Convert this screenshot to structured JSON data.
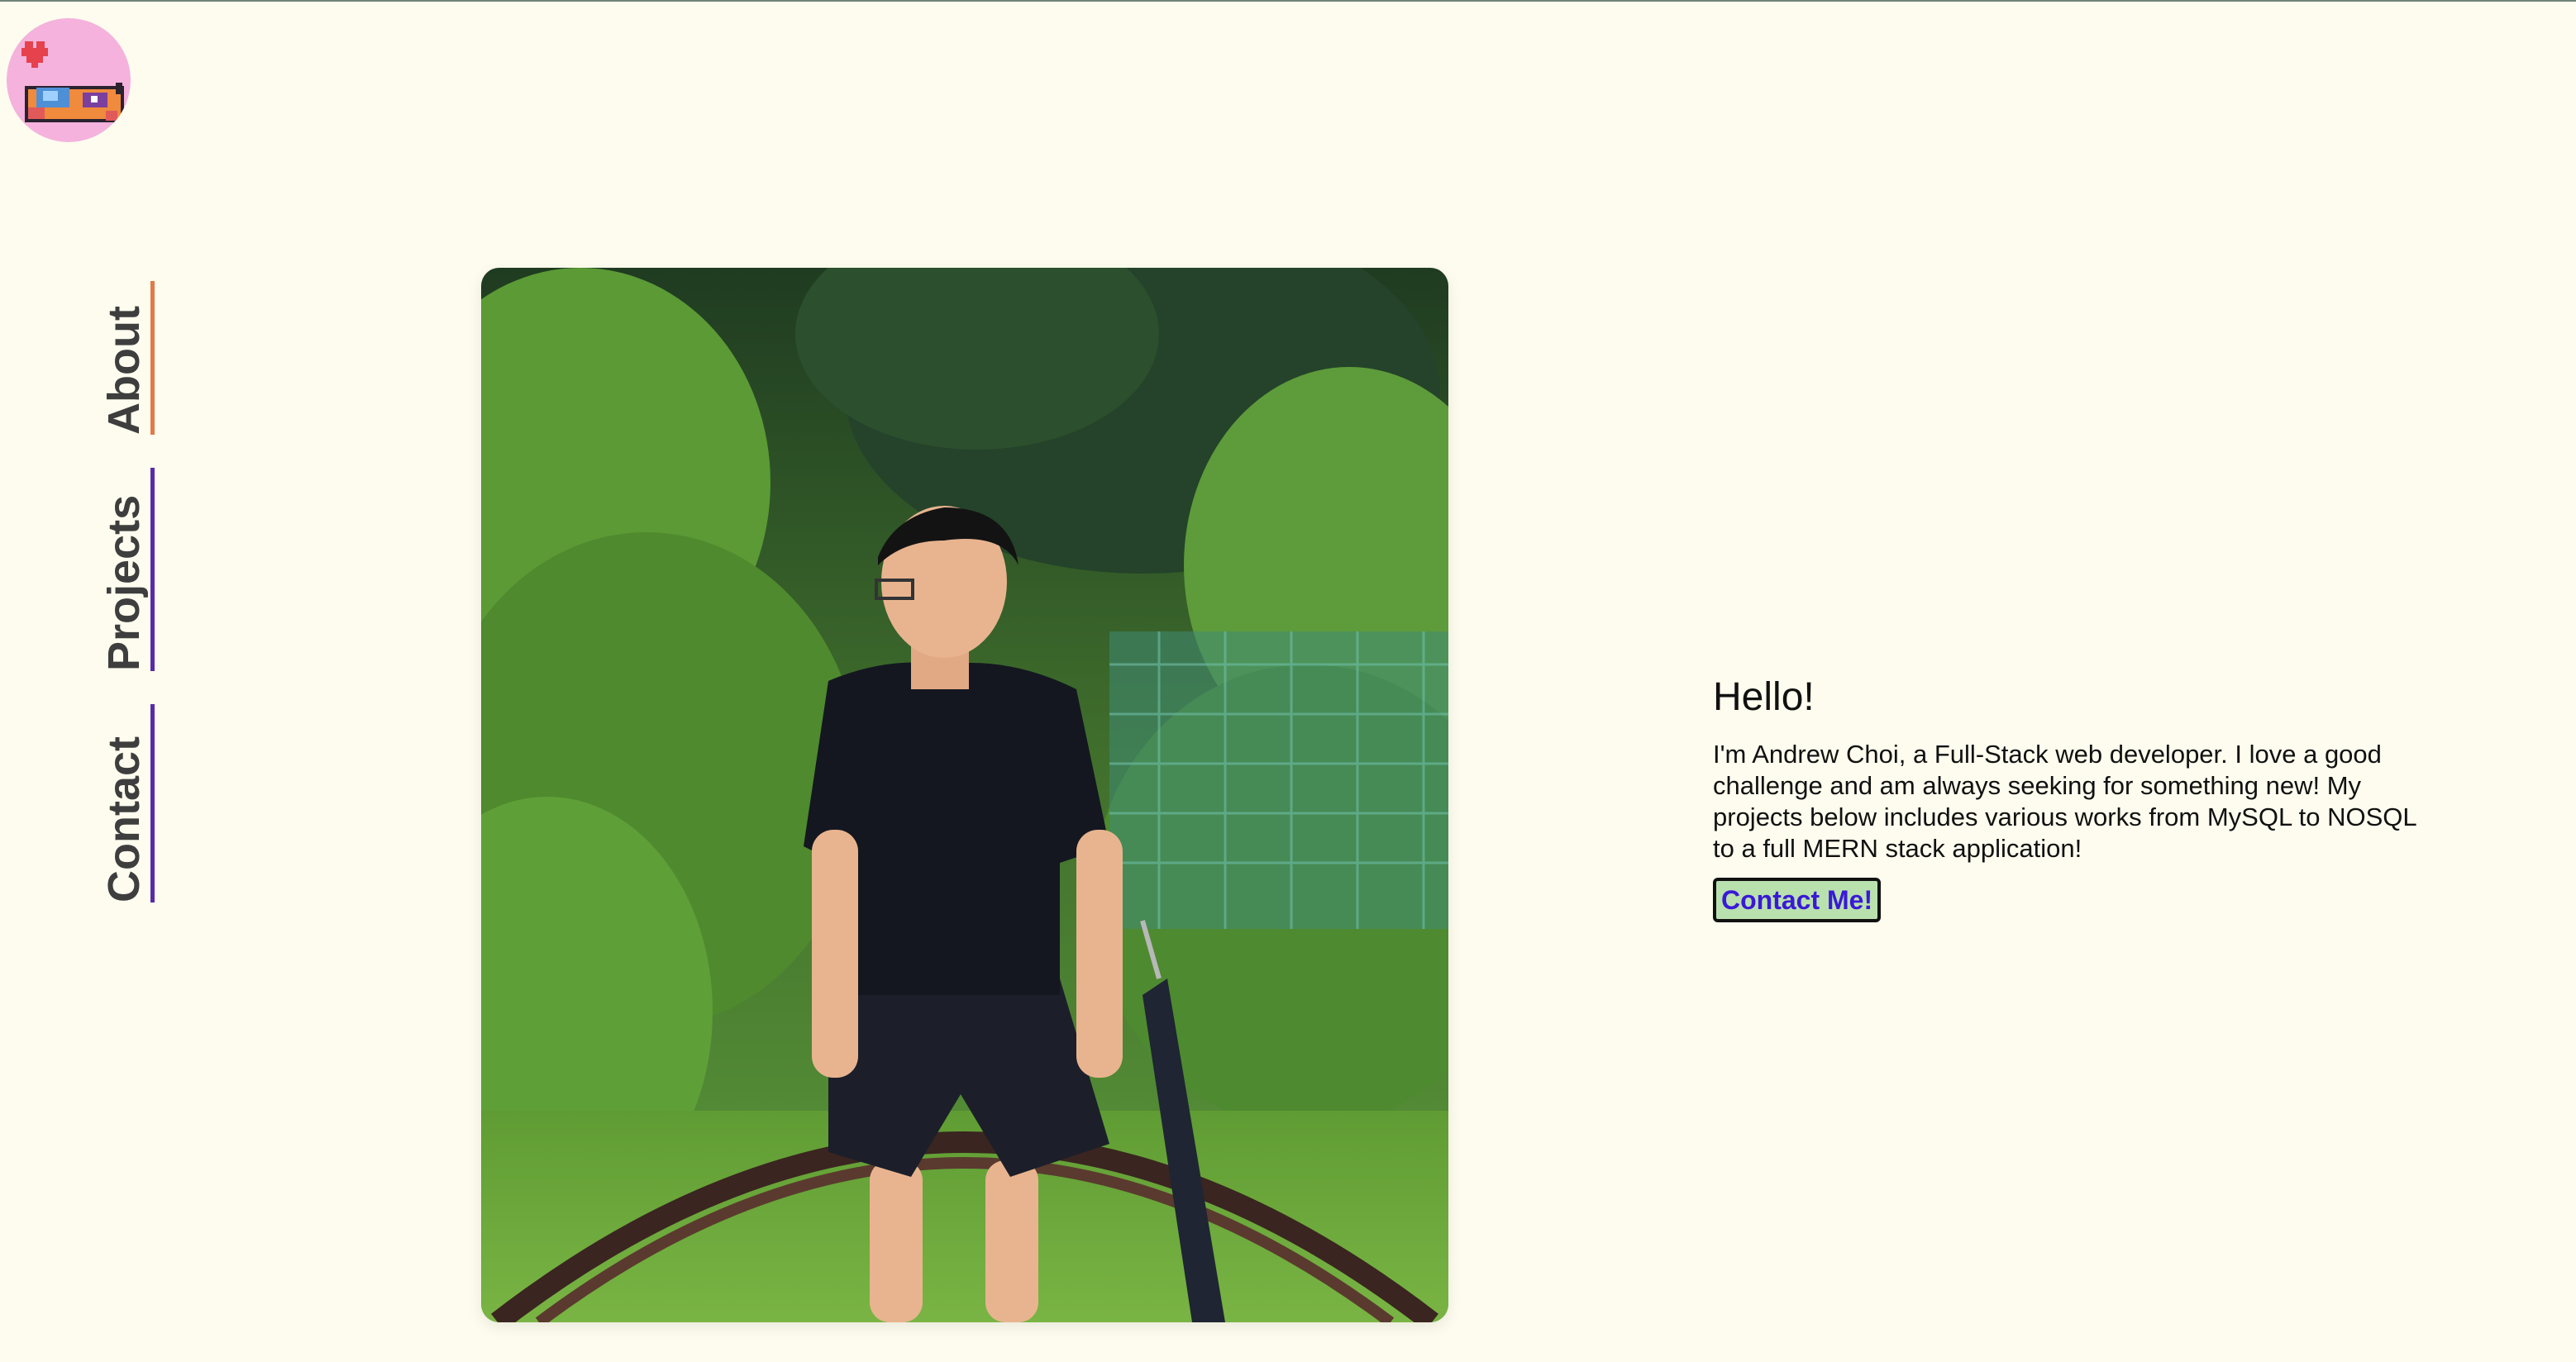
{
  "logo": {
    "icon": "pixel-dog-heart-icon",
    "background": "#f4b2dd"
  },
  "nav": {
    "items": [
      {
        "label": "About",
        "underline_color": "#e07a4a"
      },
      {
        "label": "Projects",
        "underline_color": "#5a2aa8"
      },
      {
        "label": "Contact",
        "underline_color": "#5a2aa8"
      }
    ]
  },
  "intro": {
    "heading": "Hello!",
    "body": "I'm Andrew Choi, a Full-Stack web developer. I love a good challenge and am always seeking for something new! My projects below includes various works from MySQL to NOSQL to a full MERN stack application!",
    "button_label": "Contact Me!"
  },
  "colors": {
    "page_background": "#fdfcee",
    "button_background": "#b9e1ae",
    "button_text": "#3a19d6"
  }
}
